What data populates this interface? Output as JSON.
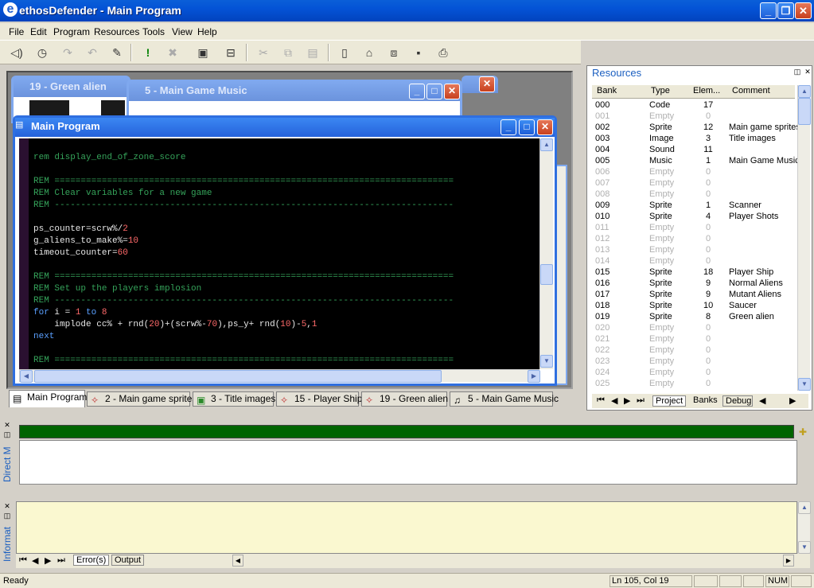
{
  "app": {
    "title": "ethosDefender - Main Program",
    "icon": "e"
  },
  "menu": [
    "File",
    "Edit",
    "Program",
    "Resources",
    "Tools",
    "View",
    "Help"
  ],
  "toolbar_icons": [
    "stop-icon",
    "step-icon",
    "step-over-icon",
    "step-out-icon",
    "breakpoint-icon",
    "run-icon",
    "cancel-icon",
    "build-icon",
    "compile-icon",
    "cut-icon",
    "copy-icon",
    "paste-icon",
    "new-icon",
    "open-icon",
    "new-window-icon",
    "save-icon",
    "print-icon"
  ],
  "windows": {
    "green_alien": {
      "title": "19 - Green alien"
    },
    "music": {
      "title": "5 - Main Game Music"
    },
    "main": {
      "title": "Main Program"
    }
  },
  "code": [
    {
      "t": "rem display_end_of_zone_score",
      "k": "rem"
    },
    {
      "t": "",
      "k": "plain"
    },
    {
      "t": "REM ============================================================================",
      "k": "rem"
    },
    {
      "t": "REM Clear variables for a new game",
      "k": "rem"
    },
    {
      "t": "REM ----------------------------------------------------------------------------",
      "k": "rem"
    },
    {
      "t": "",
      "k": "plain"
    },
    {
      "t": "ps_counter=scrw%/2",
      "k": "mix"
    },
    {
      "t": "g_aliens_to_make%=10",
      "k": "mix"
    },
    {
      "t": "timeout_counter=60",
      "k": "mix"
    },
    {
      "t": "",
      "k": "plain"
    },
    {
      "t": "REM ============================================================================",
      "k": "rem"
    },
    {
      "t": "REM Set up the players implosion",
      "k": "rem"
    },
    {
      "t": "REM ----------------------------------------------------------------------------",
      "k": "rem"
    },
    {
      "t": "for i = 1 to 8",
      "k": "mix"
    },
    {
      "t": "    implode cc% + rnd(20)+(scrw%-70),ps_y+ rnd(10)-5,1",
      "k": "mix"
    },
    {
      "t": "next",
      "k": "kw"
    },
    {
      "t": "",
      "k": "plain"
    },
    {
      "t": "REM ============================================================================",
      "k": "rem"
    }
  ],
  "tabs": [
    {
      "label": "Main Program",
      "icon": "program-icon"
    },
    {
      "label": "2 - Main game sprites",
      "icon": "sprite-icon"
    },
    {
      "label": "3 - Title images",
      "icon": "image-icon"
    },
    {
      "label": "15 - Player Ship",
      "icon": "sprite-icon"
    },
    {
      "label": "19 - Green alien",
      "icon": "sprite-icon"
    },
    {
      "label": "5 - Main Game Music",
      "icon": "music-icon"
    }
  ],
  "resources": {
    "title": "Resources",
    "columns": [
      "Bank",
      "Type",
      "Elem...",
      "Comment"
    ],
    "rows": [
      [
        "000",
        "Code",
        "17",
        ""
      ],
      [
        "001",
        "Empty",
        "0",
        ""
      ],
      [
        "002",
        "Sprite",
        "12",
        "Main game sprites"
      ],
      [
        "003",
        "Image",
        "3",
        "Title images"
      ],
      [
        "004",
        "Sound",
        "11",
        ""
      ],
      [
        "005",
        "Music",
        "1",
        "Main Game Music"
      ],
      [
        "006",
        "Empty",
        "0",
        ""
      ],
      [
        "007",
        "Empty",
        "0",
        ""
      ],
      [
        "008",
        "Empty",
        "0",
        ""
      ],
      [
        "009",
        "Sprite",
        "1",
        "Scanner"
      ],
      [
        "010",
        "Sprite",
        "4",
        "Player Shots"
      ],
      [
        "011",
        "Empty",
        "0",
        ""
      ],
      [
        "012",
        "Empty",
        "0",
        ""
      ],
      [
        "013",
        "Empty",
        "0",
        ""
      ],
      [
        "014",
        "Empty",
        "0",
        ""
      ],
      [
        "015",
        "Sprite",
        "18",
        "Player Ship"
      ],
      [
        "016",
        "Sprite",
        "9",
        "Normal Aliens"
      ],
      [
        "017",
        "Sprite",
        "9",
        "Mutant Aliens"
      ],
      [
        "018",
        "Sprite",
        "10",
        "Saucer"
      ],
      [
        "019",
        "Sprite",
        "8",
        "Green alien"
      ],
      [
        "020",
        "Empty",
        "0",
        ""
      ],
      [
        "021",
        "Empty",
        "0",
        ""
      ],
      [
        "022",
        "Empty",
        "0",
        ""
      ],
      [
        "023",
        "Empty",
        "0",
        ""
      ],
      [
        "024",
        "Empty",
        "0",
        ""
      ],
      [
        "025",
        "Empty",
        "0",
        ""
      ]
    ],
    "bottom_tabs": [
      "Project",
      "Banks",
      "Debug"
    ]
  },
  "direct": {
    "label": "Direct M"
  },
  "info": {
    "label": "Informat",
    "tabs": [
      "Error(s)",
      "Output"
    ]
  },
  "status": {
    "text": "Ready",
    "position": "Ln 105, Col 19",
    "num": "NUM"
  },
  "colors": {
    "title_blue": "#0453d6",
    "code_bg": "#000000",
    "rem_green": "#35a35a",
    "progress_green": "#006400",
    "info_bg": "#faf8d0"
  }
}
